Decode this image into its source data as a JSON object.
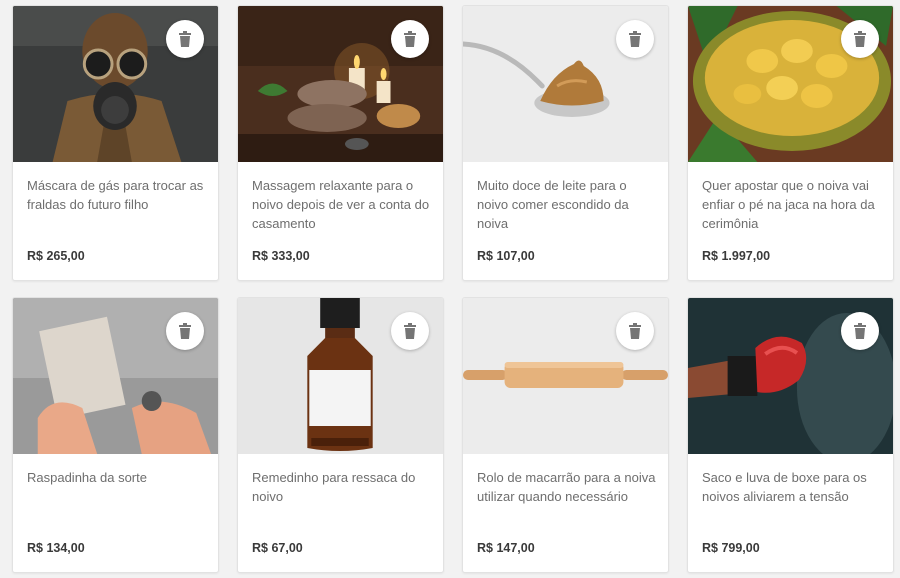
{
  "products": [
    {
      "title": "Máscara de gás para trocar as fraldas do futuro filho",
      "price": "R$ 265,00",
      "image": "gas-mask-photo"
    },
    {
      "title": "Massagem relaxante para o noivo depois de ver a conta do casamento",
      "price": "R$ 333,00",
      "image": "spa-towels-candles-photo"
    },
    {
      "title": "Muito doce de leite para o noivo comer escondido da noiva",
      "price": "R$ 107,00",
      "image": "spoon-doce-de-leite-photo"
    },
    {
      "title": "Quer apostar que o noiva vai enfiar o pé na jaca na hora da cerimônia",
      "price": "R$ 1.997,00",
      "image": "jackfruit-photo"
    },
    {
      "title": "Raspadinha da sorte",
      "price": "R$ 134,00",
      "image": "scratch-card-photo"
    },
    {
      "title": "Remedinho para ressaca do noivo",
      "price": "R$ 67,00",
      "image": "medicine-bottle-photo"
    },
    {
      "title": "Rolo de macarrão para a noiva utilizar quando necessário",
      "price": "R$ 147,00",
      "image": "rolling-pin-photo"
    },
    {
      "title": "Saco e luva de boxe para os noivos aliviarem a tensão",
      "price": "R$ 799,00",
      "image": "boxing-glove-photo"
    }
  ],
  "delete_icon": "trash-icon",
  "colors": {
    "title_text": "#6e6e6e",
    "price_text": "#3a3a3a",
    "card_bg": "#ffffff",
    "icon": "#757575"
  }
}
